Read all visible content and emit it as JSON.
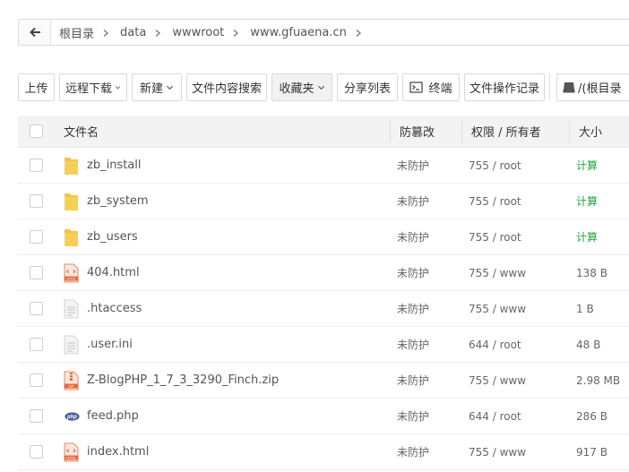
{
  "breadcrumb": {
    "items": [
      "根目录",
      "data",
      "wwwroot",
      "www.gfuaena.cn"
    ]
  },
  "toolbar": {
    "upload": "上传",
    "remote_download": "远程下载",
    "new": "新建",
    "content_search": "文件内容搜索",
    "favorites": "收藏夹",
    "share_list": "分享列表",
    "terminal": "终端",
    "file_log": "文件操作记录",
    "disk": "/(根目录"
  },
  "table": {
    "headers": {
      "name": "文件名",
      "protect": "防篡改",
      "perm": "权限 / 所有者",
      "size": "大小"
    },
    "rows": [
      {
        "name": "zb_install",
        "icon": "folder-icon",
        "protect": "未防护",
        "perm": "755 / root",
        "size": "计算"
      },
      {
        "name": "zb_system",
        "icon": "folder-icon",
        "protect": "未防护",
        "perm": "755 / root",
        "size": "计算"
      },
      {
        "name": "zb_users",
        "icon": "folder-icon",
        "protect": "未防护",
        "perm": "755 / root",
        "size": "计算"
      },
      {
        "name": "404.html",
        "icon": "html-file-icon",
        "protect": "未防护",
        "perm": "755 / www",
        "size": "138 B"
      },
      {
        "name": ".htaccess",
        "icon": "text-file-icon",
        "protect": "未防护",
        "perm": "755 / www",
        "size": "1 B"
      },
      {
        "name": ".user.ini",
        "icon": "text-file-icon",
        "protect": "未防护",
        "perm": "644 / root",
        "size": "48 B"
      },
      {
        "name": "Z-BlogPHP_1_7_3_3290_Finch.zip",
        "icon": "zip-file-icon",
        "protect": "未防护",
        "perm": "755 / www",
        "size": "2.98 MB"
      },
      {
        "name": "feed.php",
        "icon": "php-file-icon",
        "protect": "未防护",
        "perm": "644 / root",
        "size": "286 B"
      },
      {
        "name": "index.html",
        "icon": "html-file-icon",
        "protect": "未防护",
        "perm": "755 / www",
        "size": "917 B"
      }
    ]
  },
  "colors": {
    "calc_green": "#20a53a",
    "folder_yellow": "#f5c342",
    "html_orange": "#e8683a",
    "php_blue": "#4f5b93"
  }
}
